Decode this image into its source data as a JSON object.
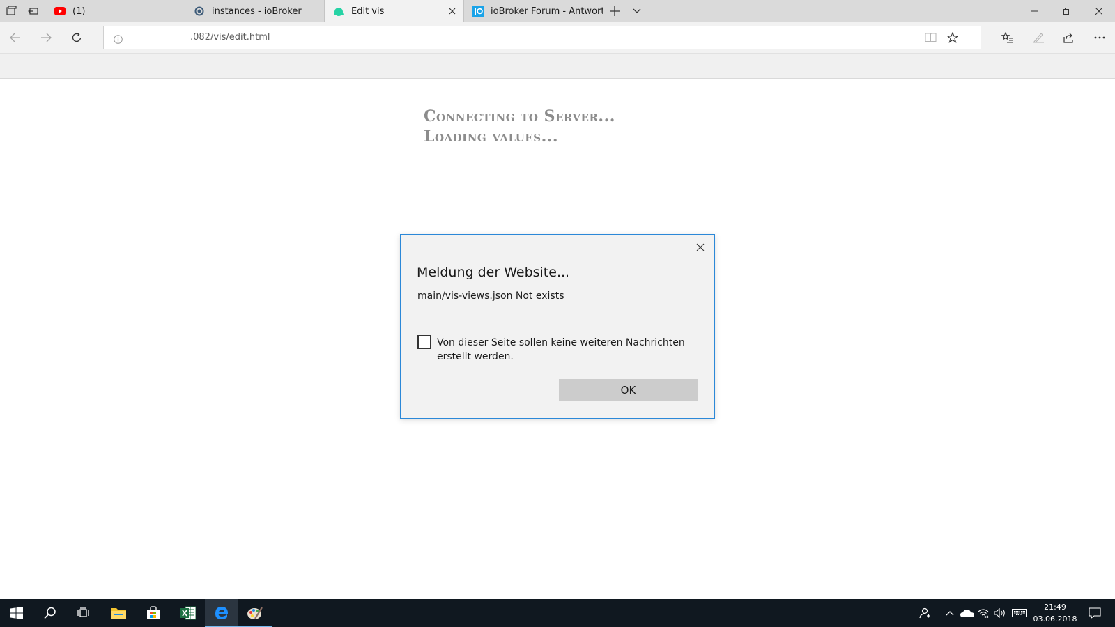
{
  "browser": {
    "tabs": [
      {
        "title": "(1)",
        "favicon": "youtube-icon",
        "active": false
      },
      {
        "title": "instances - ioBroker",
        "favicon": "iobroker-gear-icon",
        "active": false
      },
      {
        "title": "Edit vis",
        "favicon": "vis-icon",
        "active": true
      },
      {
        "title": "ioBroker Forum - Antwort e",
        "favicon": "iobroker-forum-icon",
        "active": false
      }
    ],
    "address": {
      "url": ".082/vis/edit.html"
    }
  },
  "page": {
    "status_connecting": "Connecting to Server...",
    "status_loading": "Loading values..."
  },
  "dialog": {
    "title": "Meldung der Website...",
    "message": "main/vis-views.json Not exists",
    "checkbox_label": "Von dieser Seite sollen keine weiteren Nachrichten erstellt werden.",
    "checkbox_checked": false,
    "ok_label": "OK"
  },
  "taskbar": {
    "apps": [
      "start-icon",
      "search-icon",
      "task-view-icon",
      "file-explorer-icon",
      "store-icon",
      "excel-icon",
      "edge-icon",
      "paint-icon"
    ],
    "active_app": "edge-icon",
    "clock": {
      "time": "21:49",
      "date": "03.06.2018"
    }
  },
  "colors": {
    "accent": "#2b88d8",
    "taskbar": "#101820",
    "youtube": "#ff0000",
    "vis": "#26d3a5",
    "edge": "#1e90ff"
  }
}
